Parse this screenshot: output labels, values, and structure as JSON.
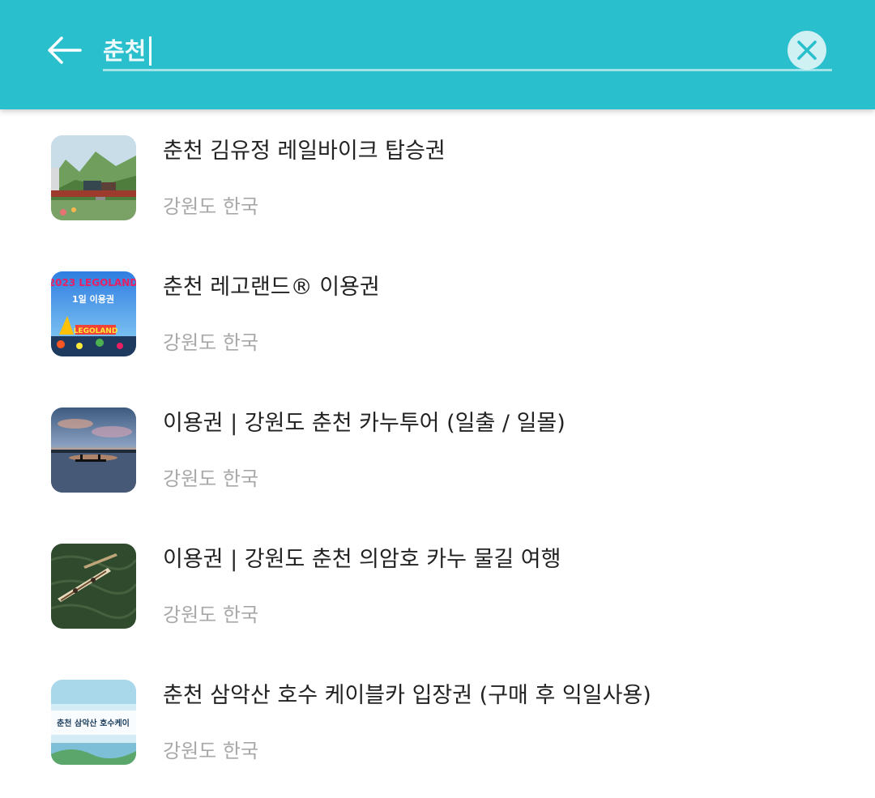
{
  "header": {
    "search_value": "춘천",
    "back_icon": "arrow-left-icon",
    "clear_icon": "close-circle-icon",
    "accent_color": "#2abfcc"
  },
  "results": [
    {
      "title": "춘천 김유정 레일바이크 탑승권",
      "subtitle": "강원도 한국",
      "thumb_icon": "rail-bike-photo"
    },
    {
      "title": "춘천 레고랜드® 이용권",
      "subtitle": "강원도 한국",
      "thumb_icon": "legoland-photo",
      "thumb_banner": "2023 LEGOLAND",
      "thumb_caption": "1일 이용권",
      "thumb_logo": "LEGOLAND"
    },
    {
      "title": "이용권 | 강원도 춘천 카누투어 (일출 / 일몰)",
      "subtitle": "강원도 한국",
      "thumb_icon": "canoe-sunset-photo"
    },
    {
      "title": "이용권 | 강원도 춘천 의암호 카누 물길 여행",
      "subtitle": "강원도 한국",
      "thumb_icon": "canoe-lake-aerial-photo"
    },
    {
      "title": "춘천 삼악산 호수 케이블카 입장권  (구매 후 익일사용)",
      "subtitle": "강원도 한국",
      "thumb_icon": "cable-car-photo",
      "thumb_caption": "춘천 삼악산 호수케이"
    }
  ]
}
